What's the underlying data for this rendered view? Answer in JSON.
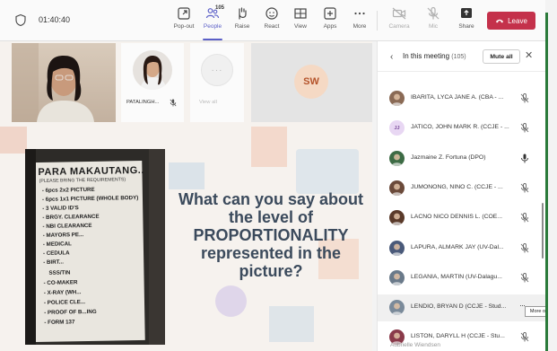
{
  "meeting": {
    "timer": "01:40:40"
  },
  "toolbar": {
    "popout": "Pop-out",
    "people": "People",
    "people_count": "105",
    "raise": "Raise",
    "react": "React",
    "view": "View",
    "apps": "Apps",
    "more": "More",
    "camera": "Camera",
    "mic": "Mic",
    "share": "Share",
    "leave": "Leave"
  },
  "stage": {
    "thumb_name": "PATALINGH...",
    "thumb3_name": "View all",
    "sw_initials": "SW",
    "question": "What can you say about the level of PROPORTIONALITY represented in the picture?",
    "sign": {
      "title": "PARA MAKAUTANG..",
      "subtitle": "(PLEASE BRING THE REQUIREMENTS)",
      "lines": [
        "- 6pcs 2x2 PICTURE",
        "- 6pcs 1x1 PICTURE (WHOLE BODY)",
        "- 3 VALID ID'S",
        "- BRGY. CLEARANCE",
        "- NBI CLEARANCE",
        "- MAYORS PE...",
        "- MEDICAL",
        "- CEDULA",
        "- BIRT...",
        "SSS/TIN",
        "- CO-MAKER",
        "- X-RAY (WH...",
        "- POLICE CLE...",
        "- PROOF OF B...ING",
        "- FORM 137"
      ]
    }
  },
  "panel": {
    "title": "In this meeting",
    "count": "(105)",
    "mute_all": "Mute all",
    "participants": [
      {
        "name": "IBARITA, LYCA JANE A. (CBA - ...",
        "initials": "",
        "avatar_color": "#8a6a55",
        "mic": "muted",
        "more": false
      },
      {
        "name": "JATICO, JOHN MARK R. (CCJE - ...",
        "initials": "JJ",
        "avatar_color": "#e8d7f3",
        "mic": "muted",
        "more": false
      },
      {
        "name": "Jazmaine Z. Fortuna (DPO)",
        "initials": "",
        "avatar_color": "#3d6b45",
        "mic": "on",
        "more": false
      },
      {
        "name": "JUMONONG, NINO C. (CCJE - ...",
        "initials": "",
        "avatar_color": "#6b4a3a",
        "mic": "muted",
        "more": false
      },
      {
        "name": "LACNO NICO DENNIS L. (COE...",
        "initials": "",
        "avatar_color": "#5a3a2a",
        "mic": "muted",
        "more": false
      },
      {
        "name": "LAPURA, ALMARK JAY (UV-Dal...",
        "initials": "",
        "avatar_color": "#4a5a7a",
        "mic": "muted",
        "more": false
      },
      {
        "name": "LEGANIA, MARTIN (UV-Dalagu...",
        "initials": "",
        "avatar_color": "#6a7a8a",
        "mic": "muted",
        "more": false
      },
      {
        "name": "LENDIO, BRYAN D (CCJE - Stud...",
        "initials": "",
        "avatar_color": "#7a8a9a",
        "mic": "",
        "more": true
      },
      {
        "name": "LISTON, DARYLL H (CCJE - Stu...",
        "initials": "",
        "avatar_color": "#8a3a4a",
        "mic": "muted",
        "more": false
      }
    ],
    "partial_row": "Aubrielle Wiendsen",
    "tooltip": "More op"
  },
  "colors": {
    "accent": "#5b5fc7",
    "leave": "#c4314b",
    "question_text": "#3b4a5c"
  }
}
